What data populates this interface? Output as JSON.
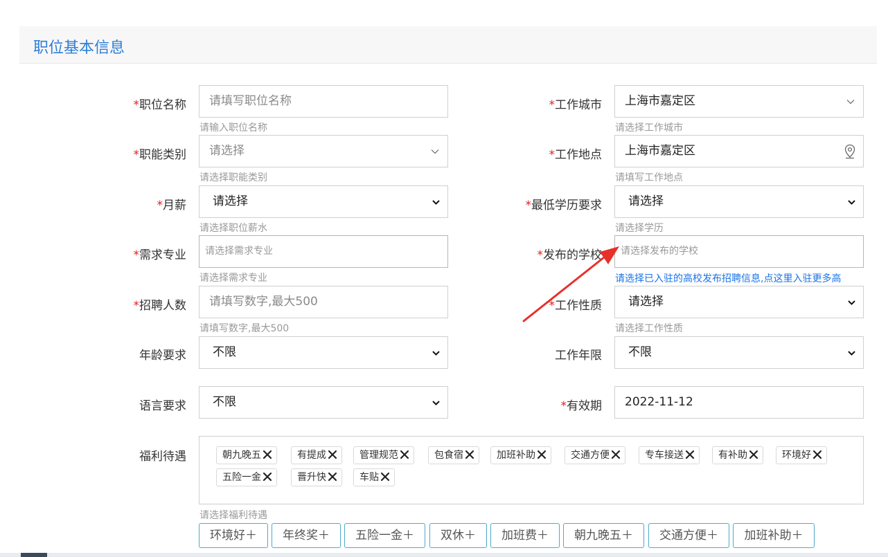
{
  "section": {
    "title": "职位基本信息"
  },
  "form": {
    "job_name": {
      "label": "职位名称",
      "required": "*",
      "placeholder": "请填写职位名称",
      "hint": "请输入职位名称"
    },
    "work_city": {
      "label": "工作城市",
      "required": "*",
      "value": "上海市嘉定区",
      "hint": "请选择工作城市"
    },
    "job_category": {
      "label": "职能类别",
      "required": "*",
      "value": "请选择",
      "hint": "请选择职能类别"
    },
    "work_location": {
      "label": "工作地点",
      "required": "*",
      "value": "上海市嘉定区",
      "hint": "请填写工作地点"
    },
    "salary": {
      "label": "月薪",
      "required": "*",
      "value": "请选择",
      "hint": "请选择职位薪水"
    },
    "education": {
      "label": "最低学历要求",
      "required": "*",
      "value": "请选择",
      "hint": "请选择学历"
    },
    "major": {
      "label": "需求专业",
      "required": "*",
      "placeholder": "请选择需求专业",
      "hint": "请选择需求专业"
    },
    "school": {
      "label": "发布的学校",
      "required": "*",
      "placeholder": "请选择发布的学校",
      "hint": "请选择已入驻的高校发布招聘信息,点这里入驻更多高"
    },
    "headcount": {
      "label": "招聘人数",
      "required": "*",
      "placeholder": "请填写数字,最大500",
      "hint": "请填写数字,最大500"
    },
    "job_type": {
      "label": "工作性质",
      "required": "*",
      "value": "请选择",
      "hint": "请选择工作性质"
    },
    "age": {
      "label": "年龄要求",
      "value": "不限"
    },
    "years": {
      "label": "工作年限",
      "value": "不限"
    },
    "language": {
      "label": "语言要求",
      "value": "不限"
    },
    "valid_until": {
      "label": "有效期",
      "required": "*",
      "value": "2022-11-12"
    },
    "benefits": {
      "label": "福利待遇",
      "hint": "请选择福利待遇",
      "selected": [
        "朝九晚五",
        "有提成",
        "管理规范",
        "包食宿",
        "加班补助",
        "交通方便",
        "专车接送",
        "有补助",
        "环境好",
        "五险一金",
        "晋升快",
        "车贴"
      ],
      "options": [
        "环境好＋",
        "年终奖＋",
        "五险一金＋",
        "双休＋",
        "加班费＋",
        "朝九晚五＋",
        "交通方便＋",
        "加班补助＋"
      ]
    }
  },
  "colors": {
    "accent": "#2e7fd8",
    "required": "#e02020",
    "link": "#1a73e8",
    "arrow": "#e8302a",
    "chip_border": "#4fa9c9"
  },
  "icons": {
    "select_caret": "chevron-down-icon",
    "location": "map-pin-icon",
    "remove": "close-icon"
  }
}
